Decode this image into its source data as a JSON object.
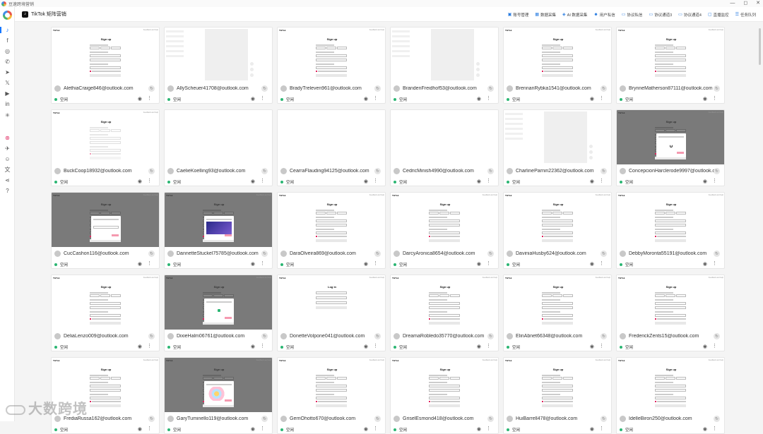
{
  "window": {
    "title": "豆速跨境营销",
    "controls": [
      "—",
      "◻",
      "✕"
    ]
  },
  "header": {
    "app_title": "TikTok 矩阵营销"
  },
  "toolbar": [
    {
      "label": "账号管理",
      "icon": "account-icon"
    },
    {
      "label": "数据采集",
      "icon": "grid-icon"
    },
    {
      "label": "AI 数据采集",
      "icon": "ai-icon"
    },
    {
      "label": "用户私信",
      "icon": "user-icon"
    },
    {
      "label": "协议私信",
      "icon": "message-icon"
    },
    {
      "label": "协议通道3",
      "icon": "message-icon"
    },
    {
      "label": "协议通道4",
      "icon": "message-icon"
    },
    {
      "label": "直播监控",
      "icon": "live-icon"
    },
    {
      "label": "任务队列",
      "icon": "queue-icon"
    }
  ],
  "sidebar": [
    "tiktok-icon",
    "facebook-icon",
    "instagram-icon",
    "whatsapp-icon",
    "telegram-icon",
    "x-icon",
    "youtube-icon",
    "linkedin-icon",
    "asterisk-icon",
    "dribbble-icon",
    "bird-icon",
    "smile-icon",
    "translate-icon",
    "share-icon",
    "help-icon"
  ],
  "page_text": {
    "tiktok_logo": "TikTok",
    "help": "Feedback and help",
    "signup_title": "Sign up",
    "login_title": "Log in"
  },
  "status_label": "空闲",
  "cards": [
    {
      "email": "AlethiaCraige846@outlook.com",
      "view": "signup"
    },
    {
      "email": "AllyScheuer41708@outlook.com",
      "view": "loading"
    },
    {
      "email": "BradyTreleven961@outlook.com",
      "view": "signup"
    },
    {
      "email": "BrandenFreidhof53@outlook.com",
      "view": "loading"
    },
    {
      "email": "BrennanRybka1541@outlook.com",
      "view": "signup"
    },
    {
      "email": "BrynneMatherson87111@outlook.com",
      "view": "signup"
    },
    {
      "email": "BuckCoop18932@outlook.com",
      "view": "signup-faded"
    },
    {
      "email": "CaelieKoelling93@outlook.com",
      "view": "blank"
    },
    {
      "email": "CearraFlauding94125@outlook.com",
      "view": "blank"
    },
    {
      "email": "CedricMinish4990@outlook.com",
      "view": "blank"
    },
    {
      "email": "CharlineParnin22362@outlook.com",
      "view": "loading"
    },
    {
      "email": "ConcepcionHarclerode9997@outlook.com",
      "view": "modal-spin"
    },
    {
      "email": "CucCashon116@outlook.com",
      "view": "modal-form"
    },
    {
      "email": "DannetteStuckel75785@outlook.com",
      "view": "modal-video"
    },
    {
      "email": "DaraOlveira869@outlook.com",
      "view": "signup"
    },
    {
      "email": "DarcyAronica8654@outlook.com",
      "view": "signup"
    },
    {
      "email": "DaviniaHusby624@outlook.com",
      "view": "signup"
    },
    {
      "email": "DebbyMoronta55191@outlook.com",
      "view": "signup"
    },
    {
      "email": "DeliaLenzo009@outlook.com",
      "view": "signup"
    },
    {
      "email": "DixieHalm06761@outlook.com",
      "view": "modal-green"
    },
    {
      "email": "DonetteVolpone041@outlook.com",
      "view": "login"
    },
    {
      "email": "DreamaRobledo35770@outlook.com",
      "view": "signup"
    },
    {
      "email": "ElinAbnet66348@outlook.com",
      "view": "signup"
    },
    {
      "email": "FrederickZents15@outlook.com",
      "view": "signup"
    },
    {
      "email": "FrediaRussa162@outlook.com",
      "view": "signup"
    },
    {
      "email": "GaryTuminello119@outlook.com",
      "view": "modal-art"
    },
    {
      "email": "GerriOhotto670@outlook.com",
      "view": "signup"
    },
    {
      "email": "GriselEsmond418@outlook.com",
      "view": "signup"
    },
    {
      "email": "HuiBarrell478@outlook.com",
      "view": "signup"
    },
    {
      "email": "IdelleBiron250@outlook.com",
      "view": "signup"
    }
  ],
  "watermark": "大数跨境"
}
